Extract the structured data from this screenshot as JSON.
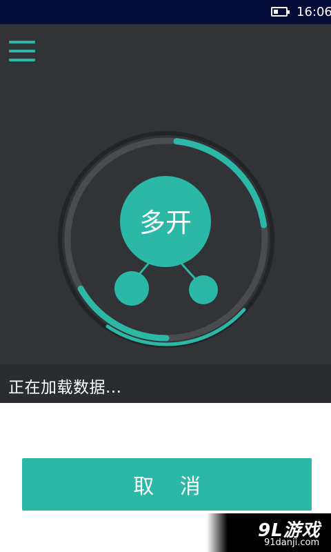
{
  "status_bar": {
    "time": "16:06",
    "battery_icon": "battery-icon"
  },
  "header": {
    "menu_icon": "hamburger-menu-icon"
  },
  "logo": {
    "label": "多开",
    "accent_color": "#2bb8a6",
    "progress_fraction": 0.35
  },
  "loading": {
    "status_text": "正在加载数据..."
  },
  "actions": {
    "cancel_label": "取 消"
  },
  "watermark": {
    "logo_text": "9L游戏",
    "url": "91danji.com"
  },
  "colors": {
    "panel_bg": "#323337",
    "accent": "#2bb8a6",
    "status_bar_bg": "#060c38"
  }
}
